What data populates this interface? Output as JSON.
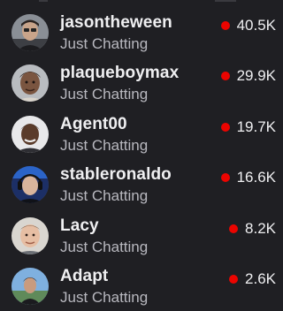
{
  "channels": [
    {
      "name": "jasontheween",
      "category": "Just Chatting",
      "viewers": "40.5K",
      "avatar_icon": "avatar-photo-icon"
    },
    {
      "name": "plaqueboymax",
      "category": "Just Chatting",
      "viewers": "29.9K",
      "avatar_icon": "avatar-photo-icon"
    },
    {
      "name": "Agent00",
      "category": "Just Chatting",
      "viewers": "19.7K",
      "avatar_icon": "avatar-photo-icon"
    },
    {
      "name": "stableronaldo",
      "category": "Just Chatting",
      "viewers": "16.6K",
      "avatar_icon": "avatar-photo-icon"
    },
    {
      "name": "Lacy",
      "category": "Just Chatting",
      "viewers": "8.2K",
      "avatar_icon": "avatar-photo-icon"
    },
    {
      "name": "Adapt",
      "category": "Just Chatting",
      "viewers": "2.6K",
      "avatar_icon": "avatar-photo-icon"
    }
  ],
  "colors": {
    "background": "#1f1f23",
    "live_indicator": "#eb0400",
    "name_text": "#efeff1",
    "category_text": "#b8b8bf"
  }
}
